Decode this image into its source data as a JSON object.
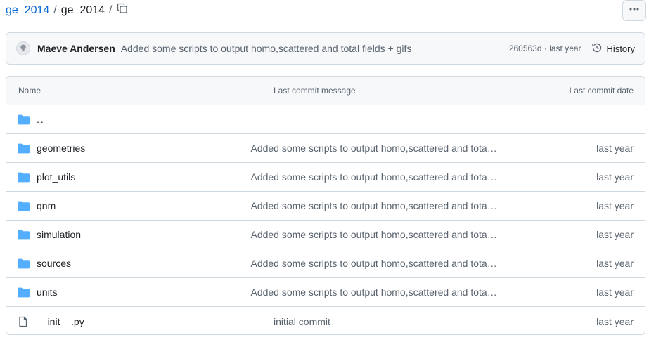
{
  "breadcrumb": {
    "root": "ge_2014",
    "separator": "/",
    "current": "ge_2014",
    "trailing": "/"
  },
  "icons": {
    "copy": "copy-icon",
    "more": "kebab-horizontal-icon",
    "avatar": "github-octocat-icon",
    "history": "history-clock-icon",
    "folder": "folder-icon",
    "file": "file-icon"
  },
  "colors": {
    "link": "#0969da",
    "folder": "#54aeff",
    "muted": "#59636e",
    "border": "#d1d9e0",
    "header_bg": "#f6f8fa"
  },
  "latest_commit": {
    "author": "Maeve Andersen",
    "message": "Added some scripts to output homo,scattered and total fields + gifs",
    "sha_time": "260563d · last year",
    "history_label": "History"
  },
  "table": {
    "headers": {
      "name": "Name",
      "message": "Last commit message",
      "date": "Last commit date"
    },
    "parent": "..",
    "rows": [
      {
        "name": "geometries",
        "message": "Added some scripts to output homo,scattered and total fields...",
        "date": "last year",
        "type": "folder"
      },
      {
        "name": "plot_utils",
        "message": "Added some scripts to output homo,scattered and total fields...",
        "date": "last year",
        "type": "folder"
      },
      {
        "name": "qnm",
        "message": "Added some scripts to output homo,scattered and total fields...",
        "date": "last year",
        "type": "folder"
      },
      {
        "name": "simulation",
        "message": "Added some scripts to output homo,scattered and total fields...",
        "date": "last year",
        "type": "folder"
      },
      {
        "name": "sources",
        "message": "Added some scripts to output homo,scattered and total fields...",
        "date": "last year",
        "type": "folder"
      },
      {
        "name": "units",
        "message": "Added some scripts to output homo,scattered and total fields...",
        "date": "last year",
        "type": "folder"
      },
      {
        "name": "__init__.py",
        "message": "initial commit",
        "date": "last year",
        "type": "file"
      }
    ]
  }
}
